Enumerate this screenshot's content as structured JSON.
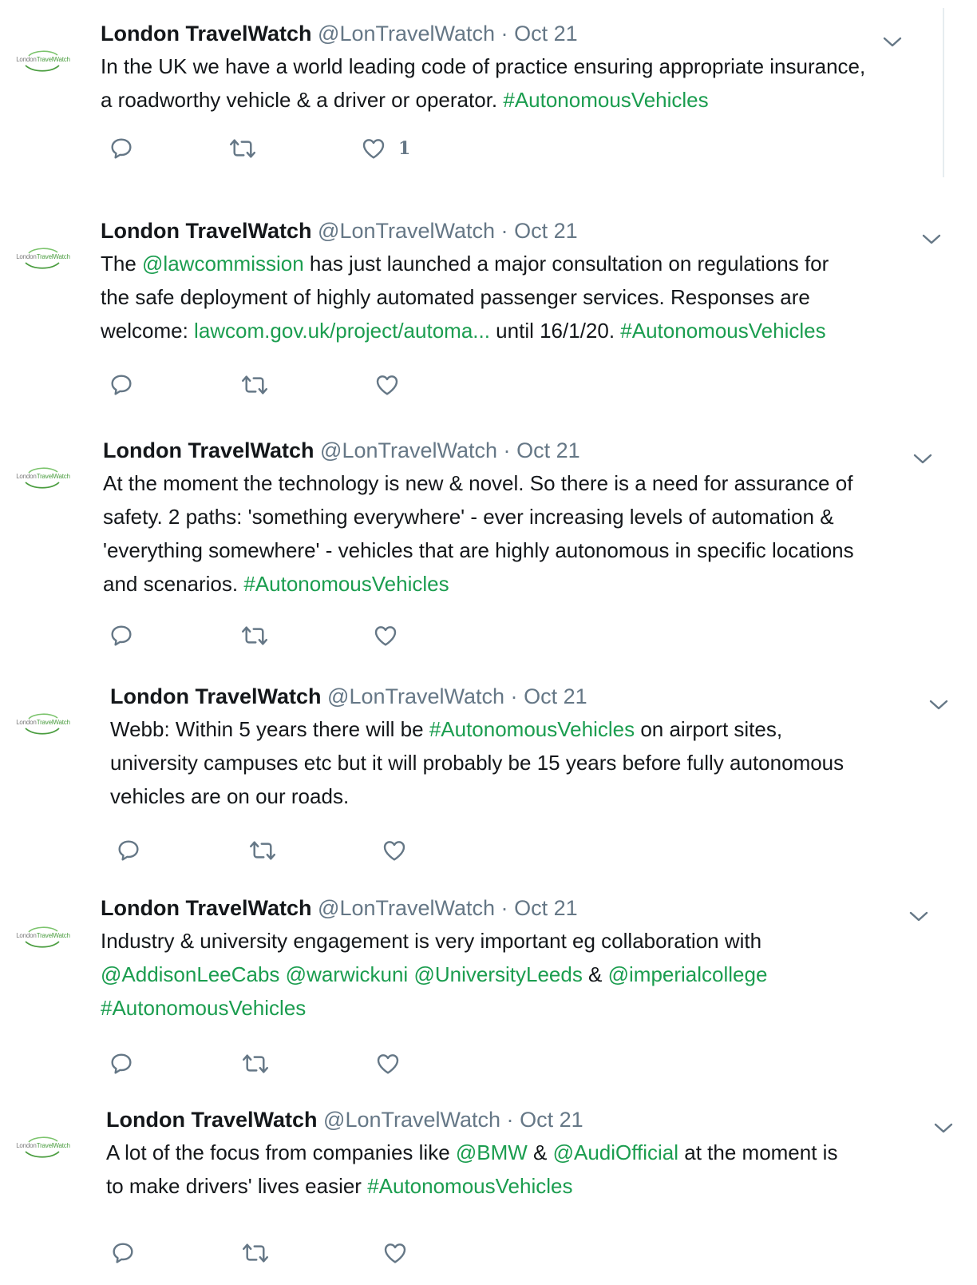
{
  "tweets": [
    {
      "avatar_text": [
        "London",
        "TravelWatch"
      ],
      "name": "London TravelWatch",
      "handle": "@LonTravelWatch",
      "sep": "·",
      "date": "Oct 21",
      "lines": [
        [
          {
            "t": "In the UK we have a world leading code of practice ensuring appropriate insurance,"
          }
        ],
        [
          {
            "t": "a roadworthy vehicle & a driver or operator. "
          },
          {
            "t": "#AutonomousVehicles",
            "link": true
          }
        ]
      ],
      "likes": "1"
    },
    {
      "avatar_text": [
        "London",
        "TravelWatch"
      ],
      "name": "London TravelWatch",
      "handle": "@LonTravelWatch",
      "sep": "·",
      "date": "Oct 21",
      "lines": [
        [
          {
            "t": "The "
          },
          {
            "t": "@lawcommission",
            "link": true
          },
          {
            "t": " has just launched a major consultation on regulations for"
          }
        ],
        [
          {
            "t": "the safe deployment of highly automated passenger services. Responses are"
          }
        ],
        [
          {
            "t": "welcome: "
          },
          {
            "t": "lawcom.gov.uk/project/automa...",
            "link": true
          },
          {
            "t": " until 16/1/20. "
          },
          {
            "t": "#AutonomousVehicles",
            "link": true
          }
        ]
      ],
      "likes": ""
    },
    {
      "avatar_text": [
        "London",
        "TravelWatch"
      ],
      "name": "London TravelWatch",
      "handle": "@LonTravelWatch",
      "sep": "·",
      "date": "Oct 21",
      "lines": [
        [
          {
            "t": "At the moment the technology is new & novel. So there is a need for assurance of"
          }
        ],
        [
          {
            "t": "safety. 2 paths: 'something everywhere' - ever increasing levels of automation &"
          }
        ],
        [
          {
            "t": "'everything somewhere' - vehicles that are highly autonomous in specific locations"
          }
        ],
        [
          {
            "t": "and scenarios. "
          },
          {
            "t": "#AutonomousVehicles",
            "link": true
          }
        ]
      ],
      "likes": ""
    },
    {
      "avatar_text": [
        "London",
        "TravelWatch"
      ],
      "name": "London TravelWatch",
      "handle": "@LonTravelWatch",
      "sep": "·",
      "date": "Oct 21",
      "lines": [
        [
          {
            "t": "Webb: Within 5 years there will be "
          },
          {
            "t": "#AutonomousVehicles",
            "link": true
          },
          {
            "t": " on airport sites,"
          }
        ],
        [
          {
            "t": "university campuses etc but it will probably be 15 years before fully autonomous"
          }
        ],
        [
          {
            "t": "vehicles are on our roads."
          }
        ]
      ],
      "likes": ""
    },
    {
      "avatar_text": [
        "London",
        "TravelWatch"
      ],
      "name": "London TravelWatch",
      "handle": "@LonTravelWatch",
      "sep": "·",
      "date": "Oct 21",
      "lines": [
        [
          {
            "t": "Industry & university engagement is very important eg collaboration with"
          }
        ],
        [
          {
            "t": "@AddisonLeeCabs",
            "link": true
          },
          {
            "t": " "
          },
          {
            "t": "@warwickuni",
            "link": true
          },
          {
            "t": " "
          },
          {
            "t": "@UniversityLeeds",
            "link": true
          },
          {
            "t": " & "
          },
          {
            "t": "@imperialcollege",
            "link": true
          }
        ],
        [
          {
            "t": "#AutonomousVehicles",
            "link": true
          }
        ]
      ],
      "likes": ""
    },
    {
      "avatar_text": [
        "London",
        "TravelWatch"
      ],
      "name": "London TravelWatch",
      "handle": "@LonTravelWatch",
      "sep": "·",
      "date": "Oct 21",
      "lines": [
        [
          {
            "t": "A lot of the focus from companies like "
          },
          {
            "t": "@BMW",
            "link": true
          },
          {
            "t": " & "
          },
          {
            "t": "@AudiOfficial",
            "link": true
          },
          {
            "t": " at the moment is"
          }
        ],
        [
          {
            "t": "to make drivers' lives easier "
          },
          {
            "t": "#AutonomousVehicles",
            "link": true
          }
        ]
      ],
      "likes": ""
    }
  ],
  "icons": {
    "reply": "reply-icon",
    "retweet": "retweet-icon",
    "like": "heart-icon",
    "menu": "chevron-down-icon"
  },
  "colors": {
    "link": "#1b9d4f",
    "meta": "#657786",
    "icon": "#657786"
  }
}
